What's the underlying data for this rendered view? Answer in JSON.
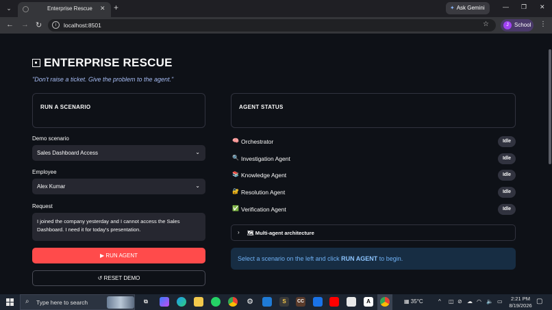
{
  "browser": {
    "tab_title": "Enterprise Rescue",
    "url": "localhost:8501",
    "gemini_label": "Ask Gemini",
    "profile_initial": "J",
    "profile_name": "School"
  },
  "app": {
    "title": "ENTERPRISE RESCUE",
    "tagline": "\"Don't raise a ticket. Give the problem to the agent.\"",
    "scenario_card_title": "RUN A SCENARIO",
    "demo_scenario_label": "Demo scenario",
    "demo_scenario_value": "Sales Dashboard Access",
    "employee_label": "Employee",
    "employee_value": "Alex Kumar",
    "request_label": "Request",
    "request_value": "I joined the company yesterday and I cannot access the Sales Dashboard. I need it for today's presentation.",
    "run_button": "▶ RUN AGENT",
    "reset_button": "↺ RESET DEMO",
    "status_card_title": "AGENT STATUS",
    "agents": [
      {
        "icon": "🧠",
        "icon_name": "brain-icon",
        "name": "Orchestrator",
        "status": "Idle"
      },
      {
        "icon": "🔍",
        "icon_name": "magnifier-icon",
        "name": "Investigation Agent",
        "status": "Idle"
      },
      {
        "icon": "📚",
        "icon_name": "books-icon",
        "name": "Knowledge Agent",
        "status": "Idle"
      },
      {
        "icon": "🔐",
        "icon_name": "lock-key-icon",
        "name": "Resolution Agent",
        "status": "Idle"
      },
      {
        "icon": "✅",
        "icon_name": "check-icon",
        "name": "Verification Agent",
        "status": "Idle"
      }
    ],
    "expander_label": "🗺 Multi-agent architecture",
    "info_prefix": "Select a scenario on the left and click ",
    "info_bold": "RUN AGENT",
    "info_suffix": " to begin."
  },
  "taskbar": {
    "search_placeholder": "Type here to search",
    "weather": "35°C",
    "time": "2:21 PM",
    "date": "8/19/2026"
  },
  "colors": {
    "background": "#0e1117",
    "primary": "#ff4b4b",
    "info_bg": "#172d43",
    "info_text": "#6fb1f5",
    "tagline": "#a7bdf5"
  }
}
